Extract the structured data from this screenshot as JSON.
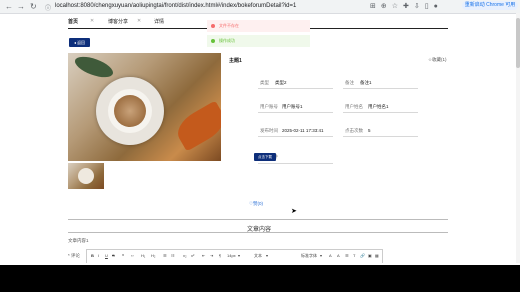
{
  "browser": {
    "url": "localhost:8080/chengxuyuan/aoliupingtai/front/dist/index.html#/index/bokeforumDetail?id=1",
    "update_label": "重新启动 Chrome 可用"
  },
  "nav": {
    "items": [
      {
        "label": "首页"
      },
      {
        "label": "博客分享"
      },
      {
        "label": "详情"
      }
    ]
  },
  "toasts": {
    "error": "文件不存在",
    "success": "操作成功"
  },
  "back_label": "返回",
  "detail": {
    "title": "主题1",
    "collect": "☆收藏(1)",
    "fields": {
      "type_label": "类型",
      "type_value": "类型2",
      "note_label": "备注",
      "note_value": "备注1",
      "account_label": "用户账号",
      "account_value": "用户账号1",
      "name_label": "用户姓名",
      "name_value": "用户姓名1",
      "time_label": "发布时间",
      "time_value": "2025-02-11 17:33:41",
      "clicks_label": "点击次数",
      "clicks_value": "5",
      "file_label": "博客文件",
      "download_label": "点击下载"
    },
    "like": "♡赞(0)"
  },
  "content": {
    "section_title": "文章内容",
    "body_text": "文章内容1",
    "comment_label": "* 评论"
  },
  "toolbar": [
    "B",
    "I",
    "U",
    "S",
    "❝",
    "‹›",
    "H₁",
    "H₂",
    "☰",
    "☷",
    "x₂",
    "x²",
    "⇤",
    "⇥",
    "¶",
    "14px",
    "▾",
    "文本",
    "▾",
    "标准字体",
    "▾",
    "A",
    "A",
    "☰",
    "T",
    "🔗",
    "▣",
    "▦"
  ]
}
